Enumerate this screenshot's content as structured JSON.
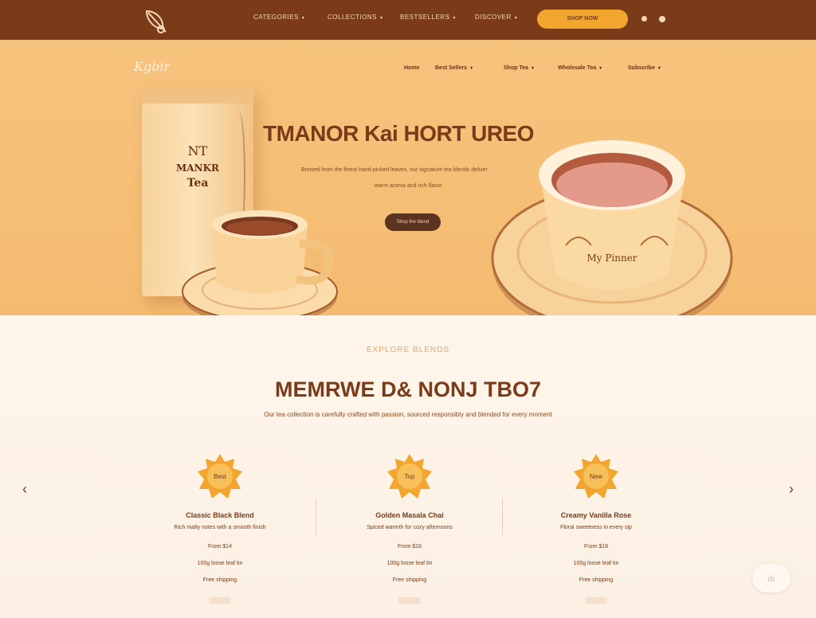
{
  "topbar": {
    "nav": [
      "CATEGORIES",
      "COLLECTIONS",
      "BESTSELLERS",
      "DISCOVER"
    ],
    "cta": "SHOP NOW"
  },
  "hero": {
    "brand": "Kgbir",
    "brand_suffix": "",
    "subnav": [
      "Home",
      "Best Sellers",
      "Shop Tea",
      "Wholesale Tea",
      "Subscribe"
    ],
    "title": "TMANOR Kai HORT UREO",
    "lines": [
      "Brewed from the finest hand-picked leaves, our signature tea blends deliver",
      "warm aroma and rich flavor"
    ],
    "button": "Shop the blend",
    "pack_top": "NT",
    "pack_mid": "MANKR",
    "pack_bottom": "Tea",
    "cup_text": "My Pinner"
  },
  "section": {
    "kicker": "EXPLORE BLENDS",
    "title": "MEMRWE D& NONJ TBO7",
    "subtitle": "Our tea collection is carefully crafted with passion, sourced responsibly and blended for every moment"
  },
  "cards": [
    {
      "badge": "Best",
      "title": "Classic Black Blend",
      "line1": "Rich malty notes with a smooth finish",
      "line2": "From $14",
      "line3": "100g loose leaf tin",
      "line4": "Free shipping"
    },
    {
      "badge": "Top",
      "title": "Golden Masala Chai",
      "line1": "Spiced warmth for cozy afternoons",
      "line2": "From $16",
      "line3": "100g loose leaf tin",
      "line4": "Free shipping"
    },
    {
      "badge": "New",
      "title": "Creamy Vanilla Rose",
      "line1": "Floral sweetness in every sip",
      "line2": "From $18",
      "line3": "100g loose leaf tin",
      "line4": "Free shipping"
    }
  ],
  "chat": "ai",
  "colors": {
    "dark_brown": "#7b3a18",
    "accent": "#f2a62e",
    "hero_bg": "#f6c37d",
    "cream": "#fcefe0"
  }
}
